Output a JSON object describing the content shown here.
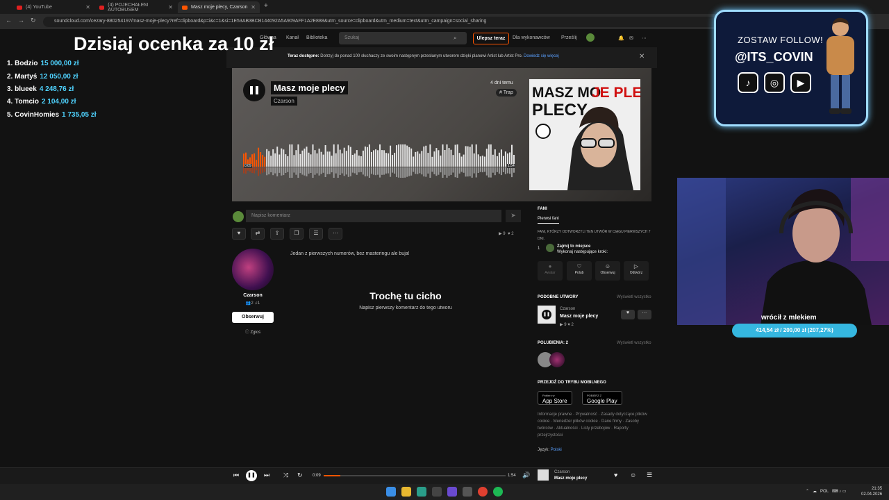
{
  "browser": {
    "tabs": [
      {
        "title": "(4) YouTube"
      },
      {
        "title": "(4) POJECHAŁEM AUTOBUSEM"
      },
      {
        "title": "Masz moje plecy, Czarson"
      }
    ],
    "url": "soundcloud.com/cezary-880254197/masz-moje-plecy?ref=clipboard&p=i&c=1&si=1E53AB3BCB144092A5A909AFF1A2E888&utm_source=clipboard&utm_medium=text&utm_campaign=social_sharing"
  },
  "header": {
    "nav": [
      "Główna",
      "Kanał",
      "Biblioteka"
    ],
    "search_placeholder": "Szukaj",
    "upgrade": "Ulepsz teraz",
    "for_artists": "Dla wykonawców",
    "upload": "Prześlij"
  },
  "notice": {
    "bold": "Teraz dostępne:",
    "text": "Dotrzyj do ponad 100 słuchaczy ze swoim następnym przesłanym utworem dzięki planowi Artist lub Artist Pro.",
    "link": "Dowiedz się więcej"
  },
  "track": {
    "title": "Masz moje plecy",
    "artist": "Czarson",
    "age": "4 dni temu",
    "tag": "# Trap",
    "elapsed": "0:09",
    "duration": "1:54",
    "progress": 0.08,
    "cover_text": "MASZ MOJE PLECY"
  },
  "comment": {
    "placeholder": "Napisz komentarz"
  },
  "stats": {
    "plays": "9",
    "likes": "2"
  },
  "artist": {
    "name": "Czarson",
    "followers": "2",
    "tracks": "1",
    "follow": "Obserwuj",
    "report": "Zgłoś"
  },
  "description": "Jedan z pierwszych numerów, bez masteringu ale buja!",
  "empty": {
    "title": "Trochę tu cicho",
    "subtitle": "Napisz pierwszy komentarz do tego utworu"
  },
  "fans": {
    "title": "FANI",
    "tab": "Pierwsi fani",
    "desc": "FANI, KTÓRZY ODTWORZYLI TEN UTWÓR W CIĄGU PIERWSZYCH 7 DNI.",
    "rank": "1",
    "slot_title": "Zajmij to miejsce",
    "slot_sub": "Wykonaj następujące kroki:",
    "actions": [
      "Awatar",
      "Polub",
      "Obserwuj",
      "Odtwórz"
    ]
  },
  "similar": {
    "title": "PODOBNE UTWORY",
    "see_all": "Wyświetl wszystko",
    "artist": "Czarson",
    "track": "Masz moje plecy",
    "plays": "9",
    "likes": "2"
  },
  "likes": {
    "title": "POLUBIENIA: 2",
    "see_all": "Wyświetl wszystko"
  },
  "mobile": {
    "title": "PRZEJDŹ DO TRYBU MOBILNEGO",
    "appstore_small": "Pobierz w",
    "appstore": "App Store",
    "googleplay_small": "POBIERZ Z",
    "googleplay": "Google Play"
  },
  "footer": {
    "links": "Informacje prawne · Prywatność · Zasady dotyczące plików cookie · Menedżer plików cookie · Dane firmy · Zasoby twórców · Aktualności · Listy przebojów · Raporty przejrzystości",
    "lang_label": "Język:",
    "lang": "Polski"
  },
  "player": {
    "elapsed": "0:09",
    "duration": "1:54",
    "artist": "Czarson",
    "title": "Masz moje plecy",
    "progress": 0.09
  },
  "taskbar": {
    "lang": "POL",
    "time": "21:35",
    "date": "02.04.2026"
  },
  "overlay": {
    "title": "Dzisiaj ocenka za 10 zł",
    "leaderboard": [
      {
        "rank": "1.",
        "name": "Bodzio",
        "amount": "15 000,00 zł"
      },
      {
        "rank": "2.",
        "name": "Martyś",
        "amount": "12 050,00 zł"
      },
      {
        "rank": "3.",
        "name": "blueek",
        "amount": "4 248,76 zł"
      },
      {
        "rank": "4.",
        "name": "Tomcio",
        "amount": "2 104,00 zł"
      },
      {
        "rank": "5.",
        "name": "CovinHomies",
        "amount": "1 735,05 zł"
      }
    ],
    "follow_label": "ZOSTAW FOLLOW!",
    "handle": "@ITS_COVIN",
    "caption": "wrócił z mlekiem",
    "goal": "414,54 zł / 200,00 zł (207,27%)"
  },
  "colors": {
    "accent": "#ff5500",
    "overlay_blue": "#4fd3ff"
  }
}
